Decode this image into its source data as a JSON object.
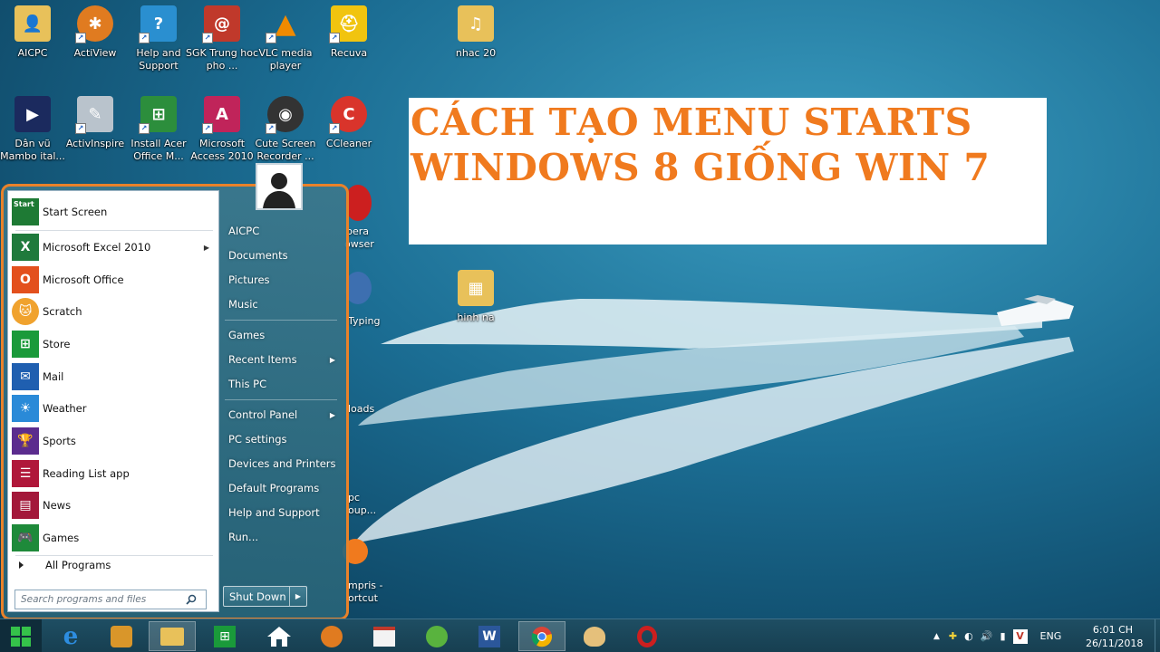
{
  "desktop": {
    "icons": [
      {
        "label": "AICPC"
      },
      {
        "label": "ActiView"
      },
      {
        "label": "Help and Support"
      },
      {
        "label": "SGK Trung hoc pho ..."
      },
      {
        "label": "VLC media player"
      },
      {
        "label": "Recuva"
      },
      {
        "label": "nhac 20"
      },
      {
        "label": "Dân vũ Mambo ital..."
      },
      {
        "label": "ActivInspire"
      },
      {
        "label": "Install Acer Office M..."
      },
      {
        "label": "Microsoft Access 2010"
      },
      {
        "label": "Cute Screen Recorder ..."
      },
      {
        "label": "CCleaner"
      },
      {
        "label": "hinh na"
      }
    ],
    "partial_labels": [
      "pera",
      "owser",
      "Typing",
      "loads",
      "pc",
      "oup...",
      "mpris -",
      "ortcut"
    ]
  },
  "banner": {
    "line1": "CÁCH TẠO MENU STARTS",
    "line2": "WINDOWS 8 GIỐNG WIN 7",
    "color": "#f07a1e"
  },
  "start_menu": {
    "pinned": {
      "label": "Start Screen"
    },
    "apps": [
      {
        "label": "Microsoft Excel 2010",
        "has_submenu": true
      },
      {
        "label": "Microsoft Office"
      },
      {
        "label": "Scratch"
      },
      {
        "label": "Store"
      },
      {
        "label": "Mail"
      },
      {
        "label": "Weather"
      },
      {
        "label": "Sports"
      },
      {
        "label": "Reading List app"
      },
      {
        "label": "News"
      },
      {
        "label": "Games"
      }
    ],
    "all_programs": "All Programs",
    "search": {
      "placeholder": "Search programs and files"
    },
    "right_items_group1": [
      {
        "label": "AICPC"
      },
      {
        "label": "Documents"
      },
      {
        "label": "Pictures"
      },
      {
        "label": "Music"
      }
    ],
    "right_items_group2": [
      {
        "label": "Games"
      },
      {
        "label": "Recent Items",
        "has_submenu": true
      },
      {
        "label": "This PC"
      }
    ],
    "right_items_group3": [
      {
        "label": "Control Panel",
        "has_submenu": true
      },
      {
        "label": "PC settings"
      },
      {
        "label": "Devices and Printers"
      },
      {
        "label": "Default Programs"
      },
      {
        "label": "Help and Support"
      },
      {
        "label": "Run..."
      }
    ],
    "shutdown_label": "Shut Down",
    "outline_color": "#e9822a"
  },
  "taskbar": {
    "language": "ENG",
    "time": "6:01 CH",
    "date": "26/11/2018"
  }
}
